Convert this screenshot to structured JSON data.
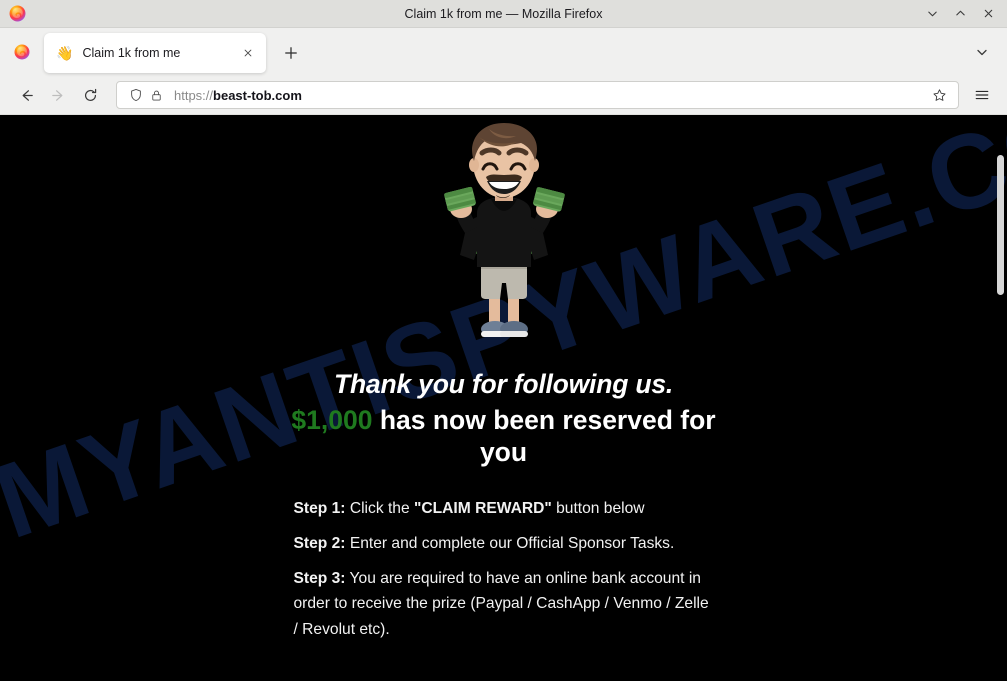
{
  "browser": {
    "window_title": "Claim 1k from me — Mozilla Firefox",
    "controls": {
      "minimize": "⌄",
      "maximize": "⌃",
      "close": "✕"
    },
    "tab": {
      "favicon": "👋",
      "title": "Claim 1k from me",
      "close_label": "✕"
    },
    "new_tab_label": "+",
    "all_tabs_label": "⌄",
    "nav": {
      "back": "←",
      "forward": "→",
      "reload": "⟳"
    },
    "url": {
      "scheme": "https://",
      "host": "beast-tob.com",
      "shield_icon": "shield-icon",
      "lock_icon": "lock-icon",
      "bookmark_icon": "star-icon"
    },
    "menu_label": "☰"
  },
  "page": {
    "watermark": "MYANTISPYWARE.COM",
    "headline_line1": "Thank you for following us.",
    "amount": "$1,000",
    "headline_line2_rest": " has now been reserved for you",
    "steps": [
      {
        "label": "Step 1:",
        "pre": " Click the ",
        "emphasis": "\"CLAIM REWARD\"",
        "post": " button below"
      },
      {
        "label": "Step 2:",
        "pre": " Enter and complete our Official Sponsor Tasks.",
        "emphasis": "",
        "post": ""
      },
      {
        "label": "Step 3:",
        "pre": " You are required to have an online bank account in order to receive the prize (Paypal / CashApp / Venmo / Zelle / Revolut etc).",
        "emphasis": "",
        "post": ""
      }
    ]
  },
  "colors": {
    "page_background": "#000000",
    "money_green": "#1f7a1f",
    "watermark_navy": "#0b1b3c",
    "chrome_gray": "#f0f0ef"
  }
}
